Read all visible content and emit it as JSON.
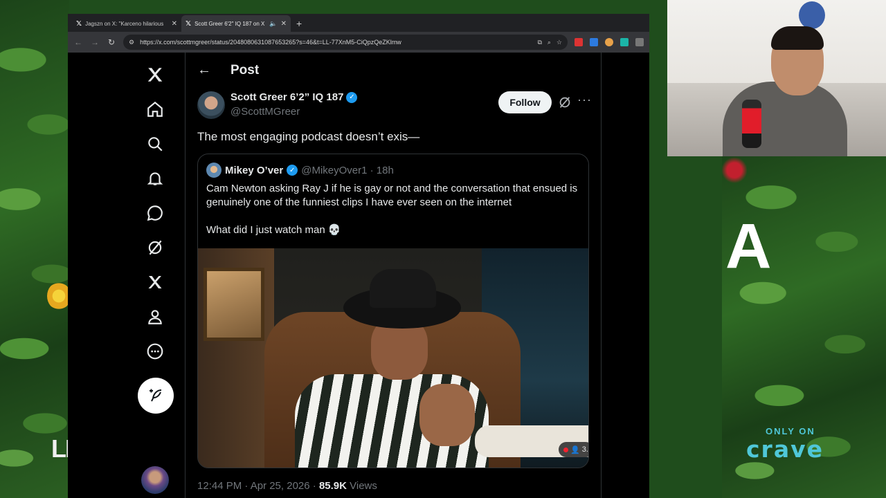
{
  "browser": {
    "tabs": [
      {
        "title": "Jagszn on X: \"Karceno hilarious",
        "active": false
      },
      {
        "title": "Scott Greer 6'2\" IQ 187 on X",
        "active": true
      }
    ],
    "url": "https://x.com/scottmgreer/status/2048080631087653265?s=46&t=LL-77XnM5-CiQpzQeZKlmw"
  },
  "post": {
    "header_title": "Post",
    "author_name": "Scott Greer 6’2” IQ 187",
    "author_handle": "@ScottMGreer",
    "follow_label": "Follow",
    "text": "The most engaging podcast doesn’t exis—",
    "timestamp": "12:44 PM · Apr 25, 2026 · ",
    "views_count": "85.9K",
    "views_label": " Views"
  },
  "quote": {
    "name": "Mikey O’ver",
    "handle": "@MikeyOver1 · 18h",
    "text": "Cam Newton asking Ray J if he is gay or not and the conversation that ensued is genuinely one of the funniest clips I have ever seen on the internet",
    "text2": "What did I just watch man 💀",
    "media_badge": "3."
  },
  "overlay": {
    "left_text": "LI",
    "right_letter": "A",
    "crave_tagline": "ONLY ON",
    "crave_logo": "crave"
  },
  "colors": {
    "accent": "#1d9bf0",
    "background": "#000000",
    "text_primary": "#e7e9ea",
    "text_secondary": "#71767b"
  }
}
